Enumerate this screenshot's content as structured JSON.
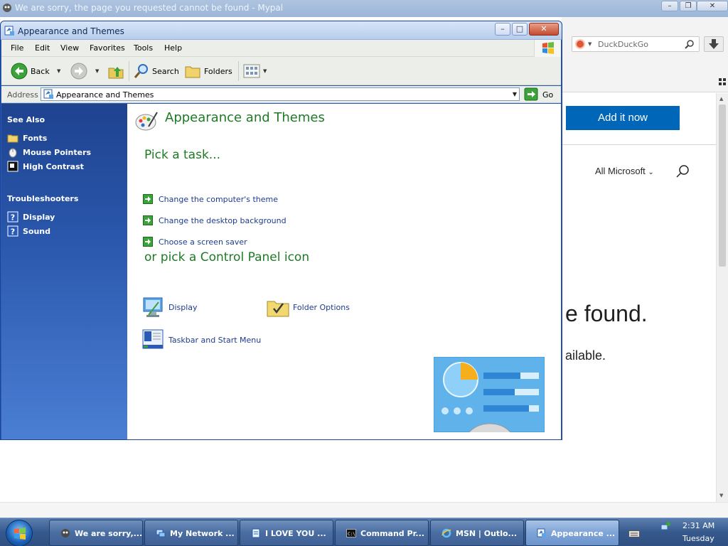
{
  "background_browser": {
    "title": "We are sorry, the page you requested cannot be found - Mypal",
    "search_placeholder": "DuckDuckGo",
    "add_it_now_label": "Add it now",
    "all_microsoft_label": "All Microsoft",
    "found_text": "e found.",
    "available_text": "ailable."
  },
  "explorer": {
    "title": "Appearance and Themes",
    "menu": [
      "File",
      "Edit",
      "View",
      "Favorites",
      "Tools",
      "Help"
    ],
    "toolbar": {
      "back_label": "Back",
      "search_label": "Search",
      "folders_label": "Folders"
    },
    "address": {
      "label": "Address",
      "value": "Appearance and Themes",
      "go_label": "Go"
    },
    "sidebar": {
      "see_also_heading": "See Also",
      "see_also_items": [
        {
          "label": "Fonts",
          "icon": "folder-icon"
        },
        {
          "label": "Mouse Pointers",
          "icon": "mouse-icon"
        },
        {
          "label": "High Contrast",
          "icon": "contrast-icon"
        }
      ],
      "troubleshooters_heading": "Troubleshooters",
      "troubleshooter_items": [
        {
          "label": "Display",
          "icon": "help-icon"
        },
        {
          "label": "Sound",
          "icon": "help-icon"
        }
      ]
    },
    "content": {
      "title": "Appearance and Themes",
      "pick_task_heading": "Pick a task...",
      "tasks": [
        "Change the computer's theme",
        "Change the desktop background",
        "Choose a screen saver"
      ],
      "or_pick_heading": "or pick a Control Panel icon",
      "icons": [
        {
          "label": "Display",
          "icon": "display-icon"
        },
        {
          "label": "Folder Options",
          "icon": "folder-options-icon"
        },
        {
          "label": "Taskbar and Start Menu",
          "icon": "taskbar-icon"
        }
      ]
    }
  },
  "taskbar": {
    "buttons": [
      {
        "label": "We are sorry,...",
        "icon": "browser-icon",
        "active": false
      },
      {
        "label": "My Network ...",
        "icon": "network-icon",
        "active": false
      },
      {
        "label": "I LOVE YOU ...",
        "icon": "document-icon",
        "active": false
      },
      {
        "label": "Command Pr...",
        "icon": "cmd-icon",
        "active": false
      },
      {
        "label": "MSN | Outlo...",
        "icon": "ie-icon",
        "active": false
      },
      {
        "label": "Appearance ...",
        "icon": "control-panel-icon",
        "active": true
      }
    ],
    "clock_time": "2:31 AM",
    "clock_day": "Tuesday"
  }
}
